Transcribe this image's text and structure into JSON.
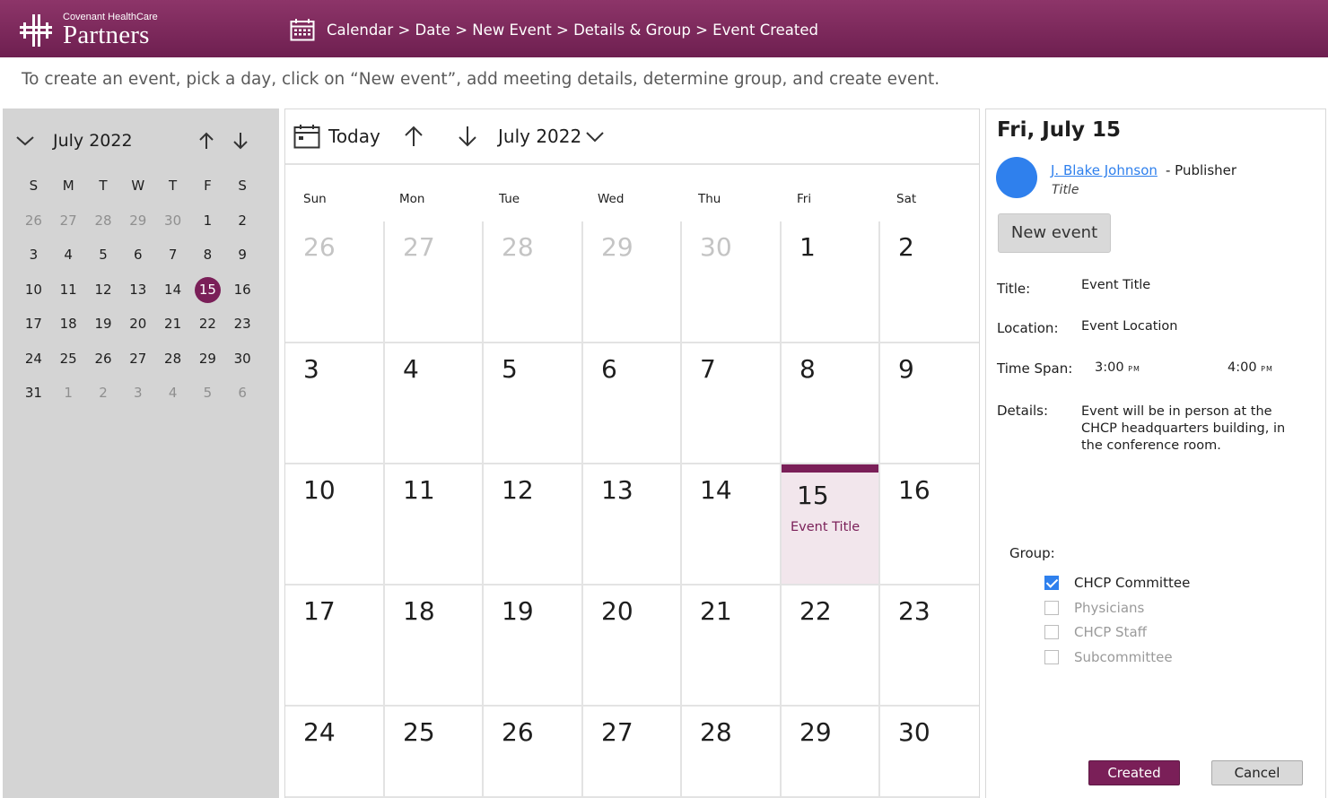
{
  "header": {
    "logo_small": "Covenant HealthCare",
    "logo_big": "Partners",
    "breadcrumb": "Calendar > Date > New Event > Details & Group > Event Created",
    "icon": "calendar-icon"
  },
  "instructions": "To create an event, pick a day, click on “New event”, add meeting details, determine group, and create event.",
  "mini_calendar": {
    "title": "July 2022",
    "weekdays": [
      "S",
      "M",
      "T",
      "W",
      "T",
      "F",
      "S"
    ],
    "weeks": [
      [
        "26",
        "27",
        "28",
        "29",
        "30",
        "1",
        "2"
      ],
      [
        "3",
        "4",
        "5",
        "6",
        "7",
        "8",
        "9"
      ],
      [
        "10",
        "11",
        "12",
        "13",
        "14",
        "15",
        "16"
      ],
      [
        "17",
        "18",
        "19",
        "20",
        "21",
        "22",
        "23"
      ],
      [
        "24",
        "25",
        "26",
        "27",
        "28",
        "29",
        "30"
      ],
      [
        "31",
        "1",
        "2",
        "3",
        "4",
        "5",
        "6"
      ]
    ],
    "selected": "15"
  },
  "toolbar": {
    "today_label": "Today",
    "month_label": "July 2022"
  },
  "main_calendar": {
    "weekdays": [
      "Sun",
      "Mon",
      "Tue",
      "Wed",
      "Thu",
      "Fri",
      "Sat"
    ],
    "weeks": [
      [
        "26",
        "27",
        "28",
        "29",
        "30",
        "1",
        "2"
      ],
      [
        "3",
        "4",
        "5",
        "6",
        "7",
        "8",
        "9"
      ],
      [
        "10",
        "11",
        "12",
        "13",
        "14",
        "15",
        "16"
      ],
      [
        "17",
        "18",
        "19",
        "20",
        "21",
        "22",
        "23"
      ],
      [
        "24",
        "25",
        "26",
        "27",
        "28",
        "29",
        "30"
      ]
    ],
    "event_day": "15",
    "event_title": "Event Title"
  },
  "panel": {
    "date": "Fri, July 15",
    "user_name": "J. Blake Johnson",
    "user_role": "- Publisher",
    "user_title": "Title",
    "new_event_label": "New event",
    "title_label": "Title:",
    "title_value": "Event Title",
    "location_label": "Location:",
    "location_value": "Event Location",
    "timespan_label": "Time Span:",
    "start_time": "3:00",
    "start_ampm": "PM",
    "end_time": "4:00",
    "end_ampm": "PM",
    "details_label": "Details:",
    "details_value": "Event will be in person at the CHCP headquarters building, in the conference room.",
    "group_label": "Group:",
    "groups": [
      {
        "label": "CHCP Committee",
        "checked": true
      },
      {
        "label": "Physicians",
        "checked": false
      },
      {
        "label": "CHCP Staff",
        "checked": false
      },
      {
        "label": "Subcommittee",
        "checked": false
      }
    ],
    "created_label": "Created",
    "cancel_label": "Cancel"
  },
  "colors": {
    "brand": "#7a1f58",
    "link": "#2f80ed",
    "event_bg": "#f2e6ec"
  }
}
